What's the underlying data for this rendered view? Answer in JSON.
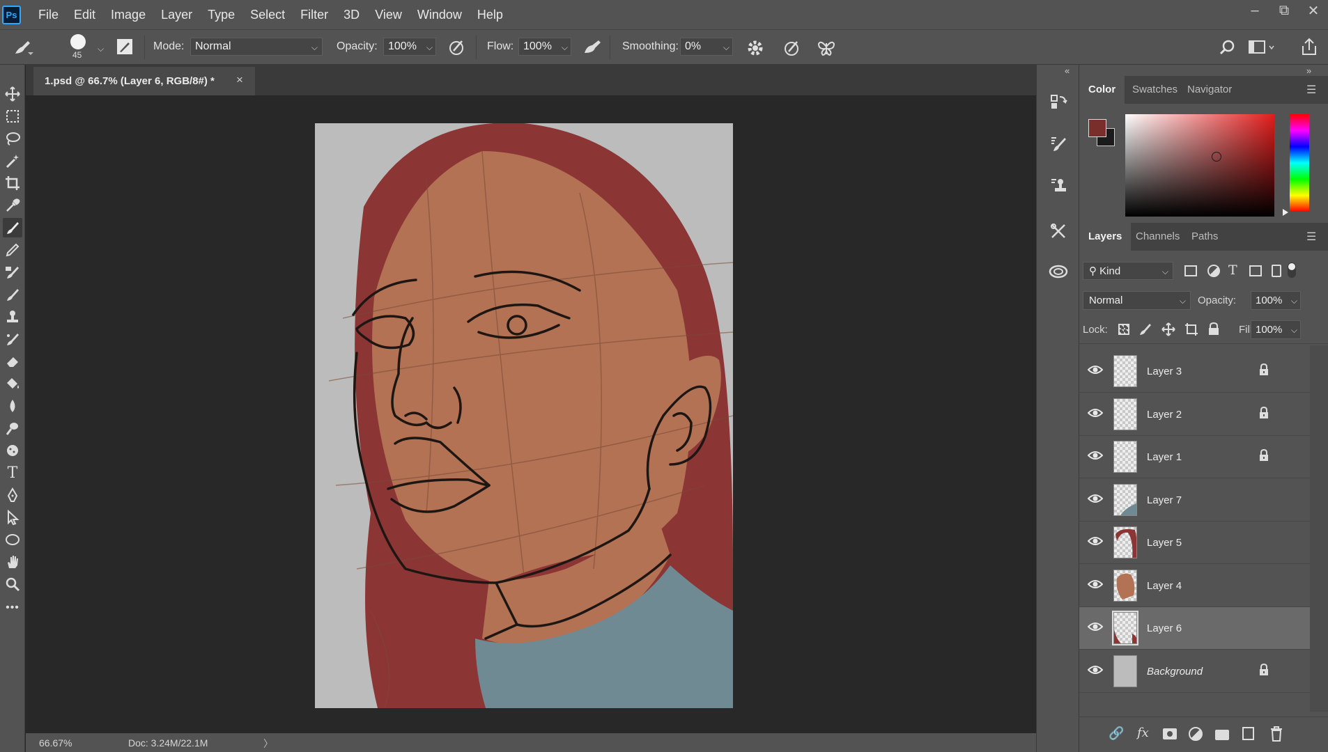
{
  "app": {
    "logo": "Ps"
  },
  "menu": [
    "File",
    "Edit",
    "Image",
    "Layer",
    "Type",
    "Select",
    "Filter",
    "3D",
    "View",
    "Window",
    "Help"
  ],
  "window_controls": {
    "minimize": "–",
    "restore": "⧉",
    "close": "✕"
  },
  "options": {
    "brush_size": "45",
    "mode_label": "Mode:",
    "mode_value": "Normal",
    "opacity_label": "Opacity:",
    "opacity_value": "100%",
    "flow_label": "Flow:",
    "flow_value": "100%",
    "smoothing_label": "Smoothing:",
    "smoothing_value": "0%"
  },
  "document": {
    "tab_label": "1.psd @ 66.7% (Layer 6, RGB/8#) *",
    "close": "×"
  },
  "status": {
    "zoom": "66.67%",
    "doc": "Doc: 3.24M/22.1M",
    "arrow": "〉"
  },
  "panels": {
    "collapse_left": "«",
    "collapse_right": "»",
    "color_tabs": [
      "Color",
      "Swatches",
      "Navigator"
    ],
    "foreground_color": "#7a2e2c",
    "background_color": "#1b1b1b",
    "layers_tabs": [
      "Layers",
      "Channels",
      "Paths"
    ],
    "filter_kind": "Kind",
    "blend_mode": "Normal",
    "opacity_label": "Opacity:",
    "opacity_value": "100%",
    "lock_label": "Lock:",
    "fill_label": "Fill:",
    "fill_value": "100%"
  },
  "layers": [
    {
      "name": "Layer 3",
      "locked": true,
      "selected": false,
      "thumb": "empty"
    },
    {
      "name": "Layer 2",
      "locked": true,
      "selected": false,
      "thumb": "empty"
    },
    {
      "name": "Layer 1",
      "locked": true,
      "selected": false,
      "thumb": "empty"
    },
    {
      "name": "Layer 7",
      "locked": false,
      "selected": false,
      "thumb": "shirt"
    },
    {
      "name": "Layer 5",
      "locked": false,
      "selected": false,
      "thumb": "hair"
    },
    {
      "name": "Layer 4",
      "locked": false,
      "selected": false,
      "thumb": "skin"
    },
    {
      "name": "Layer 6",
      "locked": false,
      "selected": true,
      "thumb": "hair-back"
    },
    {
      "name": "Background",
      "locked": true,
      "selected": false,
      "thumb": "gray"
    }
  ],
  "colors": {
    "hair": "#8c3535",
    "skin": "#b27253",
    "shirt": "#6f8a93",
    "canvas_bg": "#bcbcbc",
    "ui_panel": "#535353",
    "ui_dark": "#282828"
  }
}
